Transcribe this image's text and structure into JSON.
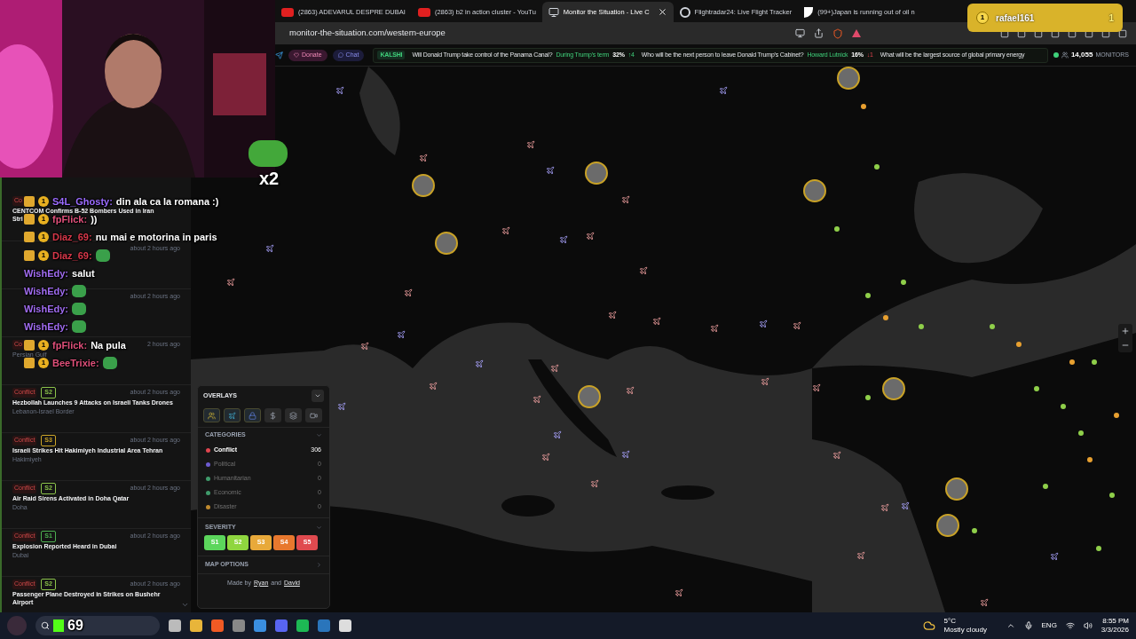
{
  "browser": {
    "tabs": [
      {
        "title": "(2863) ADEVARUL DESPRE DUBAI",
        "selected": false
      },
      {
        "title": "(2863) b2 in action cluster - YouTu",
        "selected": false
      },
      {
        "title": "Monitor the Situation - Live C",
        "selected": true
      },
      {
        "title": "Flightradar24: Live Flight Tracker",
        "selected": false
      },
      {
        "title": "(99+)Japan is running out of oil n",
        "selected": false
      }
    ],
    "notification": {
      "badge": "1",
      "user": "rafael161",
      "points": "1"
    },
    "address": "monitor-the-situation.com/western-europe"
  },
  "ticker": {
    "donate": "Donate",
    "chat": "Chat",
    "source": "KALSHI",
    "markets": [
      {
        "question": "Will Donald Trump take control of the Panama Canal?",
        "outcome": "During Trump's term",
        "percent": "32%",
        "change": "↑4",
        "rising": true
      },
      {
        "question": "Who will be the next person to leave Donald Trump's Cabinet?",
        "outcome": "Howard Lutnick",
        "percent": "16%",
        "change": "↓1",
        "rising": false
      },
      {
        "question": "What will be the largest source of global primary energy"
      }
    ],
    "monitors_count": "14,055",
    "monitors_label": "MONITORS"
  },
  "news": [
    {
      "tag": "Co",
      "title": "CENTCOM Confirms B-52 Bombers Used in Iran",
      "title2": "Stri"
    },
    {
      "time": "about 2 hours ago"
    },
    {
      "time": "about 2 hours ago"
    },
    {
      "tag": "Co",
      "time": "2 hours ago",
      "location": "Persian Gulf"
    },
    {
      "tag": "Conflict",
      "severity": "S2",
      "color": "#8bc34a",
      "time": "about 2 hours ago",
      "title": "Hezbollah Launches 9 Attacks on Israeli Tanks Drones",
      "location": "Lebanon-Israel Border"
    },
    {
      "tag": "Conflict",
      "severity": "S3",
      "color": "#c9a227",
      "time": "about 2 hours ago",
      "title": "Israeli Strikes Hit Hakimiyeh Industrial Area Tehran",
      "location": "Hakimiyeh"
    },
    {
      "tag": "Conflict",
      "severity": "S2",
      "color": "#8bc34a",
      "time": "about 2 hours ago",
      "title": "Air Raid Sirens Activated in Doha Qatar",
      "location": "Doha"
    },
    {
      "tag": "Conflict",
      "severity": "S1",
      "color": "#4caf50",
      "time": "about 2 hours ago",
      "title": "Explosion Reported Heard in Dubai",
      "location": "Dubai"
    },
    {
      "tag": "Conflict",
      "severity": "S2",
      "color": "#8bc34a",
      "time": "about 2 hours ago",
      "title": "Passenger Plane Destroyed in Strikes on Bushehr",
      "title2": "Airport"
    }
  ],
  "chat": [
    {
      "user": "S4L_Ghosty:",
      "color": "#9b6bff",
      "kind": "text",
      "message": "din ala ca la romana :)",
      "sub": "1"
    },
    {
      "user": "fpFlick:",
      "color": "#e0507a",
      "kind": "text",
      "message": "))",
      "sub": "1"
    },
    {
      "user": "Diaz_69:",
      "color": "#d8384a",
      "kind": "text",
      "message": "nu mai e motorina in paris",
      "sub": "1"
    },
    {
      "user": "Diaz_69:",
      "color": "#d8384a",
      "kind": "emote",
      "sub": "1"
    },
    {
      "user": "WishEdy:",
      "color": "#a06cf0",
      "kind": "text",
      "message": "salut"
    },
    {
      "user": "WishEdy:",
      "color": "#a06cf0",
      "kind": "emote"
    },
    {
      "user": "WishEdy:",
      "color": "#a06cf0",
      "kind": "emote"
    },
    {
      "user": "WishEdy:",
      "color": "#a06cf0",
      "kind": "emote"
    },
    {
      "user": "fpFlick:",
      "color": "#e0507a",
      "kind": "text",
      "message": "Na pula",
      "sub": "1"
    },
    {
      "user": "BeeTrixie:",
      "color": "#e0507a",
      "kind": "emote",
      "sub": "1"
    }
  ],
  "combo": "x2",
  "overlays": {
    "title": "OVERLAYS",
    "toggles": [
      {
        "on": true
      },
      {
        "on": true
      },
      {
        "on": true
      },
      {
        "on": false
      },
      {
        "on": false
      },
      {
        "on": false
      }
    ],
    "categories_label": "CATEGORIES",
    "categories": [
      {
        "name": "Conflict",
        "count": "306",
        "color": "#e0454f",
        "on": true
      },
      {
        "name": "Political",
        "count": "0",
        "color": "#6d5bd0",
        "on": false
      },
      {
        "name": "Humanitarian",
        "count": "0",
        "color": "#3f9b6b",
        "on": false
      },
      {
        "name": "Economic",
        "count": "0",
        "color": "#3f9b6b",
        "on": false
      },
      {
        "name": "Disaster",
        "count": "0",
        "color": "#c08a2e",
        "on": false
      }
    ],
    "severity_label": "SEVERITY",
    "severity": [
      {
        "label": "S1",
        "color": "#5cd65c"
      },
      {
        "label": "S2",
        "color": "#8fd63f"
      },
      {
        "label": "S3",
        "color": "#e8a93a"
      },
      {
        "label": "S4",
        "color": "#e8782e"
      },
      {
        "label": "S5",
        "color": "#e04a4f"
      }
    ],
    "map_options": "MAP OPTIONS",
    "credit_prefix": "Made by",
    "authors": [
      "Ryan",
      "David"
    ],
    "credit_joiner": "and"
  },
  "taskbar": {
    "counter": "69",
    "temp": "5°C",
    "weather": "Mostly cloudy",
    "lang": "ENG",
    "time": "8:55 PM",
    "date": "3/3/2026"
  }
}
